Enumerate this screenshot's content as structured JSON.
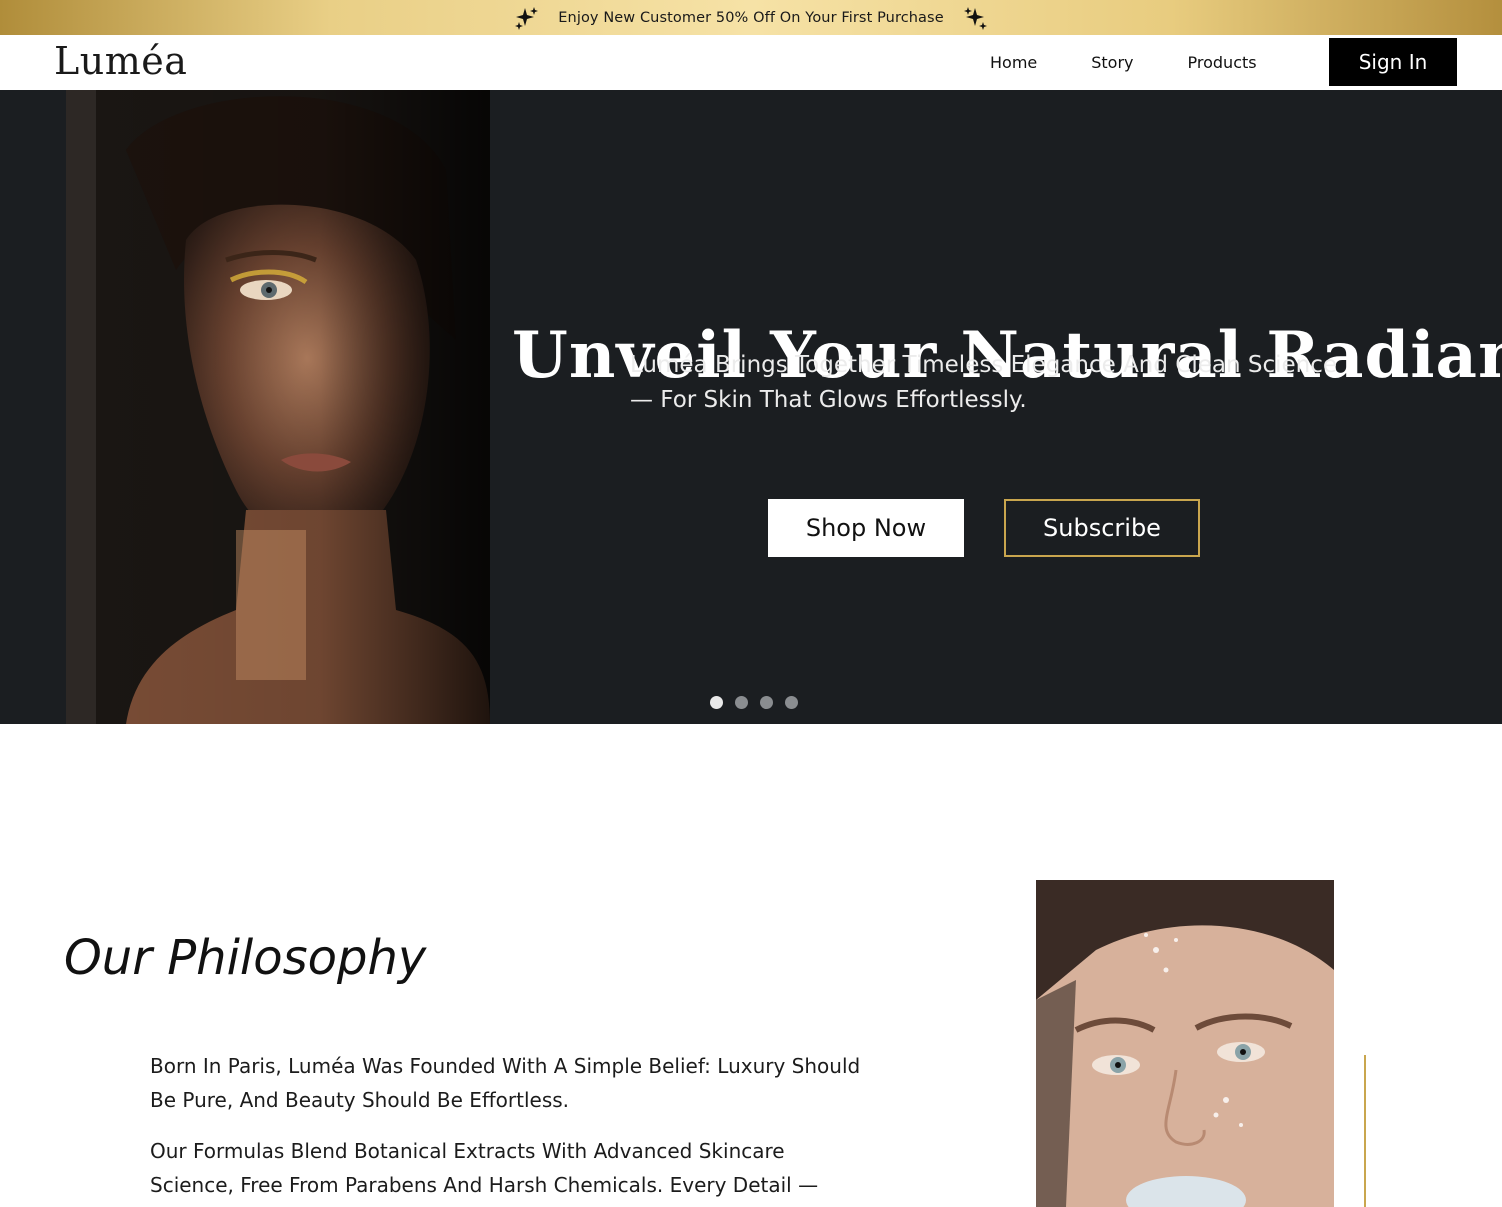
{
  "promo": {
    "text": "Enjoy New Customer 50% Off On Your First Purchase",
    "icon_left": "sparkles-icon",
    "icon_right": "sparkles-icon"
  },
  "nav": {
    "logo": "Luméa",
    "links": [
      "Home",
      "Story",
      "Products"
    ],
    "signin_label": "Sign In"
  },
  "hero": {
    "title": "Unveil Your Natural Radiance",
    "subtitle": "Luméa Brings Together Timeless Elegance And Clean Science — For Skin That Glows Effortlessly.",
    "shop_label": "Shop Now",
    "subscribe_label": "Subscribe",
    "carousel": {
      "count": 4,
      "active": 1
    }
  },
  "philosophy": {
    "title": "Our Philosophy",
    "paragraph1": "Born In Paris, Luméa Was Founded With A Simple Belief: Luxury Should Be Pure, And Beauty Should Be Effortless.",
    "paragraph2": "Our Formulas Blend Botanical Extracts With Advanced Skincare Science, Free From Parabens And Harsh Chemicals. Every Detail — From Our Eco-"
  },
  "colors": {
    "accent_gold": "#c9a64e",
    "hero_bg": "#1b1e21",
    "signin_bg": "#000000"
  }
}
